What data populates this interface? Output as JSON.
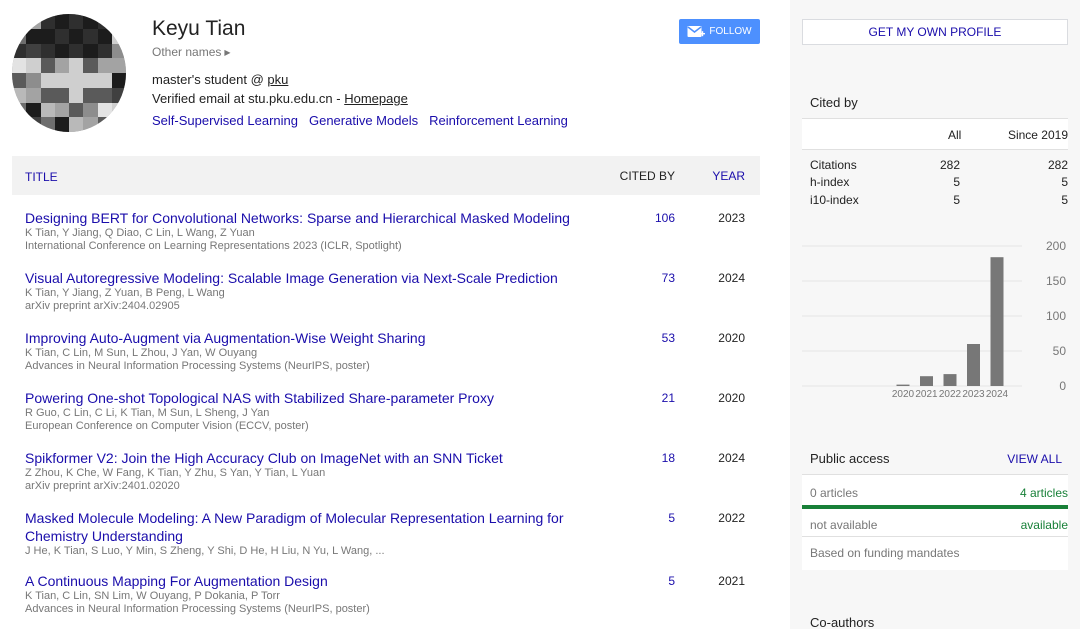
{
  "profile": {
    "name": "Keyu Tian",
    "other_names": "Other names",
    "affiliation_prefix": "master's student @ ",
    "affiliation_link": "pku",
    "email_text": "Verified email at stu.pku.edu.cn - ",
    "homepage": "Homepage",
    "interests": [
      "Self-Supervised Learning",
      "Generative Models",
      "Reinforcement Learning"
    ]
  },
  "follow_label": "FOLLOW",
  "table_header": {
    "title": "TITLE",
    "cited_by": "CITED BY",
    "year": "YEAR"
  },
  "articles": [
    {
      "title": "Designing BERT for Convolutional Networks: Sparse and Hierarchical Masked Modeling",
      "authors": "K Tian, Y Jiang, Q Diao, C Lin, L Wang, Z Yuan",
      "venue": "International Conference on Learning Representations 2023 (ICLR, Spotlight)",
      "cited_by": "106",
      "year": "2023"
    },
    {
      "title": "Visual Autoregressive Modeling: Scalable Image Generation via Next-Scale Prediction",
      "authors": "K Tian, Y Jiang, Z Yuan, B Peng, L Wang",
      "venue": "arXiv preprint arXiv:2404.02905",
      "cited_by": "73",
      "year": "2024"
    },
    {
      "title": "Improving Auto-Augment via Augmentation-Wise Weight Sharing",
      "authors": "K Tian, C Lin, M Sun, L Zhou, J Yan, W Ouyang",
      "venue": "Advances in Neural Information Processing Systems (NeurIPS, poster)",
      "cited_by": "53",
      "year": "2020"
    },
    {
      "title": "Powering One-shot Topological NAS with Stabilized Share-parameter Proxy",
      "authors": "R Guo, C Lin, C Li, K Tian, M Sun, L Sheng, J Yan",
      "venue": "European Conference on Computer Vision (ECCV, poster)",
      "cited_by": "21",
      "year": "2020"
    },
    {
      "title": "Spikformer V2: Join the High Accuracy Club on ImageNet with an SNN Ticket",
      "authors": "Z Zhou, K Che, W Fang, K Tian, Y Zhu, S Yan, Y Tian, L Yuan",
      "venue": "arXiv preprint arXiv:2401.02020",
      "cited_by": "18",
      "year": "2024"
    },
    {
      "title": "Masked Molecule Modeling: A New Paradigm of Molecular Representation Learning for Chemistry Understanding",
      "authors": "J He, K Tian, S Luo, Y Min, S Zheng, Y Shi, D He, H Liu, N Yu, L Wang, ...",
      "venue": "",
      "cited_by": "5",
      "year": "2022"
    },
    {
      "title": "A Continuous Mapping For Augmentation Design",
      "authors": "K Tian, C Lin, SN Lim, W Ouyang, P Dokania, P Torr",
      "venue": "Advances in Neural Information Processing Systems (NeurIPS, poster)",
      "cited_by": "5",
      "year": "2021"
    }
  ],
  "sidebar": {
    "get_profile": "GET MY OWN PROFILE",
    "cited_by_title": "Cited by",
    "col_all": "All",
    "col_since": "Since 2019",
    "stats": [
      {
        "label": "Citations",
        "all": "282",
        "since": "282"
      },
      {
        "label": "h-index",
        "all": "5",
        "since": "5"
      },
      {
        "label": "i10-index",
        "all": "5",
        "since": "5"
      }
    ],
    "public_access": {
      "title": "Public access",
      "view_all": "VIEW ALL",
      "zero_articles": "0 articles",
      "four_articles": "4 articles",
      "not_available": "not available",
      "available": "available",
      "funding": "Based on funding mandates"
    },
    "coauthors_title": "Co-authors"
  },
  "chart_data": {
    "type": "bar",
    "categories": [
      "2020",
      "2021",
      "2022",
      "2023",
      "2024"
    ],
    "values": [
      2,
      14,
      17,
      60,
      184
    ],
    "yticks": [
      0,
      50,
      100,
      150,
      200
    ],
    "ylim": [
      0,
      200
    ],
    "bar_color": "#777777"
  }
}
